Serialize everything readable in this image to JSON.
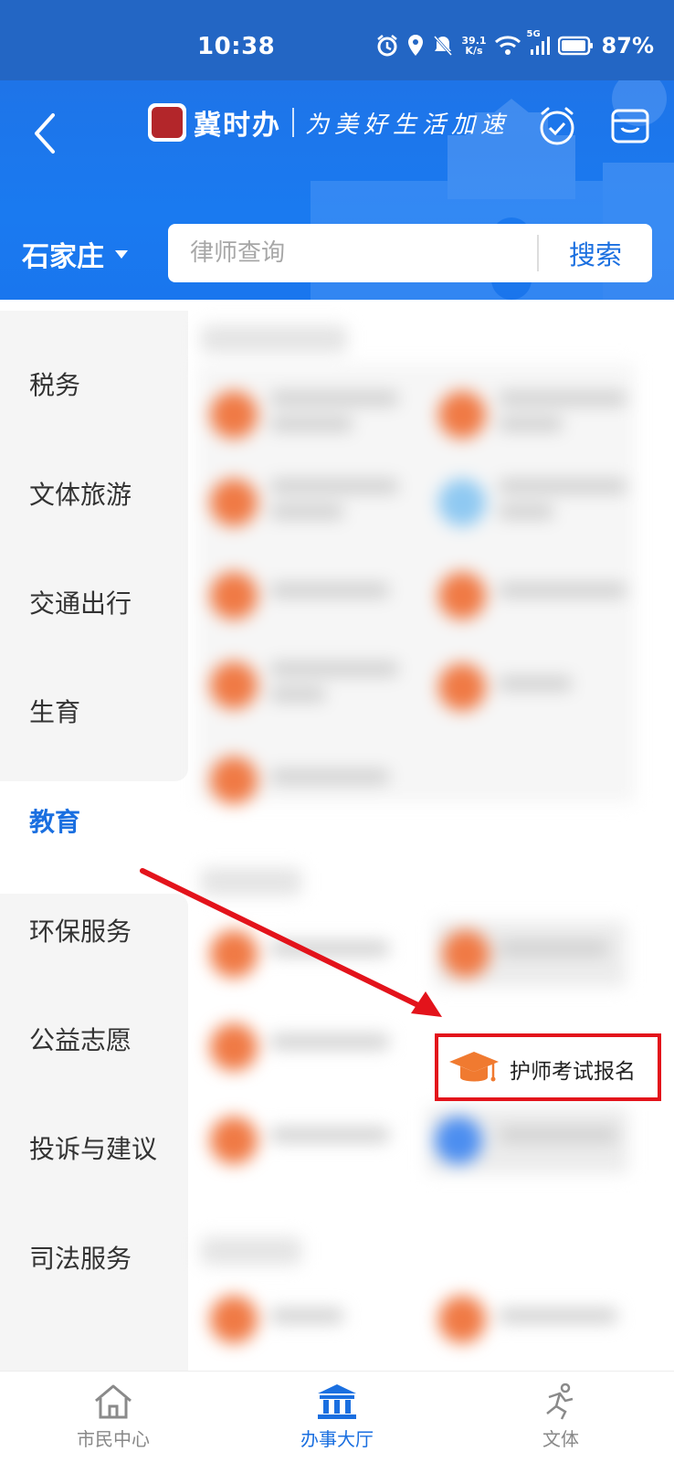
{
  "status_bar": {
    "time": "10:38",
    "net_speed_value": "39.1",
    "net_speed_unit": "K/s",
    "signal_label": "5G",
    "battery_percent": "87%"
  },
  "header": {
    "app_name": "冀时办",
    "slogan": "为美好生活加速",
    "icons": [
      "back-arrow-icon",
      "clock-check-icon",
      "wallet-icon"
    ]
  },
  "search": {
    "city": "石家庄",
    "placeholder": "律师查询",
    "button_label": "搜索"
  },
  "sidebar": {
    "items": [
      {
        "label": "税务",
        "active": false
      },
      {
        "label": "文体旅游",
        "active": false
      },
      {
        "label": "交通出行",
        "active": false
      },
      {
        "label": "生育",
        "active": false
      },
      {
        "label": "教育",
        "active": true
      },
      {
        "label": "环保服务",
        "active": false
      },
      {
        "label": "公益志愿",
        "active": false
      },
      {
        "label": "投诉与建议",
        "active": false
      },
      {
        "label": "司法服务",
        "active": false
      }
    ]
  },
  "highlighted_service": {
    "label": "护师考试报名",
    "icon": "graduation-cap-icon",
    "accent_color": "#f07a30"
  },
  "annotation": {
    "arrow_color": "#e3131b",
    "box_color": "#e3131b"
  },
  "tabbar": {
    "tabs": [
      {
        "label": "市民中心",
        "icon": "home-icon",
        "active": false
      },
      {
        "label": "办事大厅",
        "icon": "government-building-icon",
        "active": true
      },
      {
        "label": "文体",
        "icon": "running-figure-icon",
        "active": false
      }
    ]
  },
  "colors": {
    "brand_blue": "#1a6fe0",
    "header_blue": "#1e74e8",
    "status_bar_blue": "#2366c4"
  }
}
